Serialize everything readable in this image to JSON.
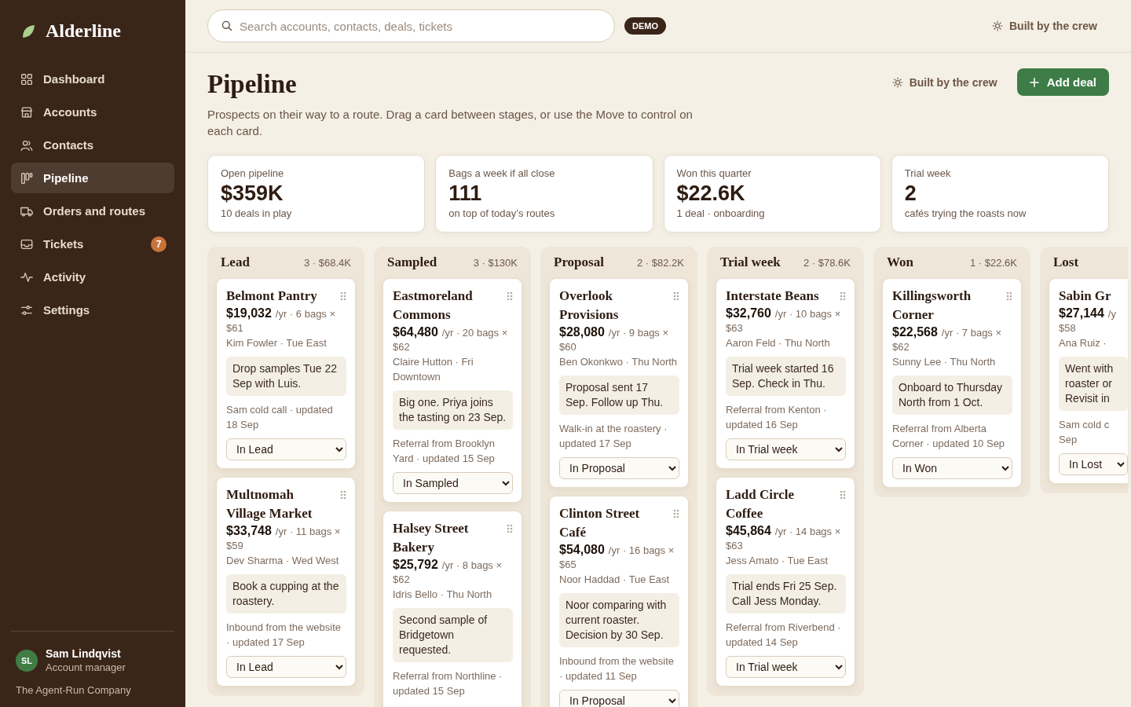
{
  "brand": {
    "name": "Alderline"
  },
  "nav": [
    {
      "label": "Dashboard",
      "selected": false
    },
    {
      "label": "Accounts",
      "selected": false
    },
    {
      "label": "Contacts",
      "selected": false
    },
    {
      "label": "Pipeline",
      "selected": true
    },
    {
      "label": "Orders and routes",
      "selected": false
    },
    {
      "label": "Tickets",
      "selected": false,
      "badge": "7"
    },
    {
      "label": "Activity",
      "selected": false
    },
    {
      "label": "Settings",
      "selected": false
    }
  ],
  "user": {
    "initials": "SL",
    "name": "Sam Lindqvist",
    "role": "Account manager",
    "company": "The Agent-Run Company"
  },
  "topbar": {
    "search_placeholder": "Search accounts, contacts, deals, tickets",
    "badge": "DEMO",
    "credit": "Built by the crew"
  },
  "page": {
    "title": "Pipeline",
    "description": "Prospects on their way to a route. Drag a card between stages, or use the Move to control on each card.",
    "credit": "Built by the crew",
    "add_button": "Add deal"
  },
  "stats": [
    {
      "label": "Open pipeline",
      "value": "$359K",
      "sub": "10 deals in play"
    },
    {
      "label": "Bags a week if all close",
      "value": "111",
      "sub": "on top of today’s routes"
    },
    {
      "label": "Won this quarter",
      "value": "$22.6K",
      "sub": "1 deal · onboarding"
    },
    {
      "label": "Trial week",
      "value": "2",
      "sub": "cafés trying the roasts now"
    }
  ],
  "stages": [
    {
      "name": "Lead",
      "summary": "3 · $68.4K",
      "cards": [
        {
          "name": "Belmont Pantry",
          "value": "$19,032",
          "rate": "/yr · 6 bags ×",
          "price": "$61",
          "contact": "Kim Fowler · Tue East",
          "note": "Drop samples Tue 22 Sep with Luis.",
          "source": "Sam cold call · updated 18 Sep",
          "stage": "In Lead"
        },
        {
          "name": "Multnomah Village Market",
          "value": "$33,748",
          "rate": "/yr · 11 bags ×",
          "price": "$59",
          "contact": "Dev Sharma · Wed West",
          "note": "Book a cupping at the roastery.",
          "source": "Inbound from the website · updated 17 Sep",
          "stage": "In Lead"
        }
      ]
    },
    {
      "name": "Sampled",
      "summary": "3 · $130K",
      "cards": [
        {
          "name": "Eastmoreland Commons",
          "value": "$64,480",
          "rate": "/yr · 20 bags ×",
          "price": "$62",
          "contact": "Claire Hutton · Fri Downtown",
          "note": "Big one. Priya joins the tasting on 23 Sep.",
          "source": "Referral from Brooklyn Yard · updated 15 Sep",
          "stage": "In Sampled"
        },
        {
          "name": "Halsey Street Bakery",
          "value": "$25,792",
          "rate": "/yr · 8 bags ×",
          "price": "$62",
          "contact": "Idris Bello · Thu North",
          "note": "Second sample of Bridgetown requested.",
          "source": "Referral from Northline · updated 15 Sep"
        }
      ]
    },
    {
      "name": "Proposal",
      "summary": "2 · $82.2K",
      "cards": [
        {
          "name": "Overlook Provisions",
          "value": "$28,080",
          "rate": "/yr · 9 bags ×",
          "price": "$60",
          "contact": "Ben Okonkwo · Thu North",
          "note": "Proposal sent 17 Sep. Follow up Thu.",
          "source": "Walk-in at the roastery · updated 17 Sep",
          "stage": "In Proposal"
        },
        {
          "name": "Clinton Street Café",
          "value": "$54,080",
          "rate": "/yr · 16 bags ×",
          "price": "$65",
          "contact": "Noor Haddad · Tue East",
          "note": "Noor comparing with current roaster. Decision by 30 Sep.",
          "source": "Inbound from the website · updated 11 Sep",
          "stage": "In Proposal"
        }
      ]
    },
    {
      "name": "Trial week",
      "summary": "2 · $78.6K",
      "cards": [
        {
          "name": "Interstate Beans",
          "value": "$32,760",
          "rate": "/yr · 10 bags ×",
          "price": "$63",
          "contact": "Aaron Feld · Thu North",
          "note": "Trial week started 16 Sep. Check in Thu.",
          "source": "Referral from Kenton · updated 16 Sep",
          "stage": "In Trial week"
        },
        {
          "name": "Ladd Circle Coffee",
          "value": "$45,864",
          "rate": "/yr · 14 bags ×",
          "price": "$63",
          "contact": "Jess Amato · Tue East",
          "note": "Trial ends Fri 25 Sep. Call Jess Monday.",
          "source": "Referral from Riverbend · updated 14 Sep",
          "stage": "In Trial week"
        }
      ]
    },
    {
      "name": "Won",
      "summary": "1 · $22.6K",
      "cards": [
        {
          "name": "Killingsworth Corner",
          "value": "$22,568",
          "rate": "/yr · 7 bags ×",
          "price": "$62",
          "contact": "Sunny Lee · Thu North",
          "note": "Onboard to Thursday North from 1 Oct.",
          "source": "Referral from Alberta Corner · updated 10 Sep",
          "stage": "In Won"
        }
      ]
    },
    {
      "name": "Lost",
      "cards": [
        {
          "name": "Sabin Gr",
          "value": "$27,144",
          "rate": "/y",
          "price": "$58",
          "contact": "Ana Ruiz ·",
          "note": "Went with roaster or Revisit in",
          "source": "Sam cold c Sep",
          "stage": "In Lost"
        }
      ]
    }
  ]
}
